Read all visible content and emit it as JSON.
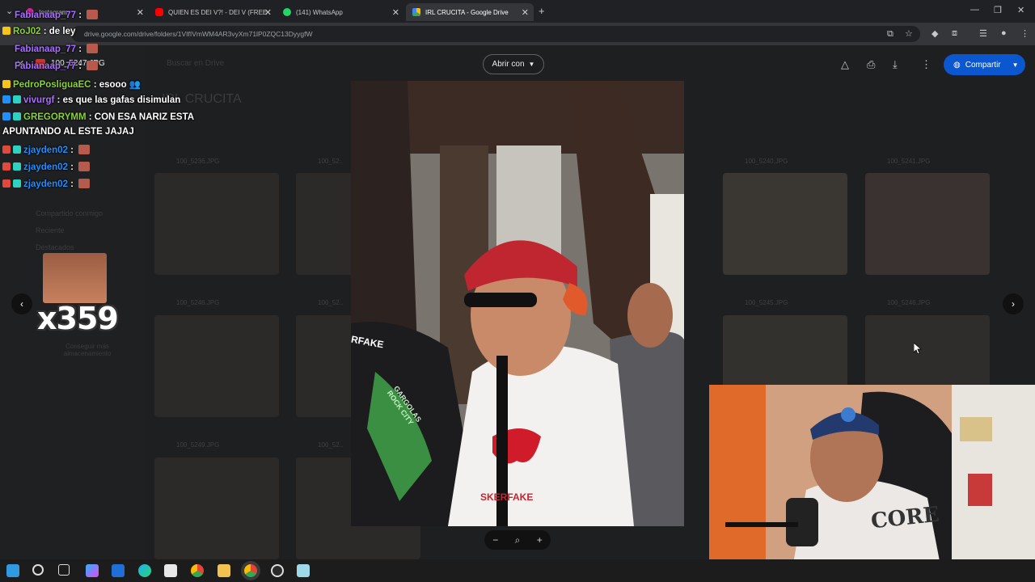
{
  "browser": {
    "tabs": [
      {
        "label": "Instagram",
        "icon": "instagram-icon",
        "color": "#d6249f"
      },
      {
        "label": "QUIEN ES DEI V?! - DEI V (FREE",
        "icon": "youtube-icon",
        "color": "#ff0000"
      },
      {
        "label": "(141) WhatsApp",
        "icon": "whatsapp-icon",
        "color": "#25d366"
      },
      {
        "label": "IRL CRUCITA - Google Drive",
        "icon": "drive-icon",
        "color": "#4285f4",
        "active": true
      }
    ],
    "new_tab": "+",
    "close_glyph": "✕",
    "url": "drive.google.com/drive/folders/1VIfIVmWM4AR3vyXm71lP0ZQC13DyygfW"
  },
  "viewer": {
    "filename": "100_5247.JPG",
    "open_with": "Abrir con",
    "share": "Compartir"
  },
  "drive_bg": {
    "search_placeholder": "Buscar en Drive",
    "folder_title": "IRL CRUCITA",
    "thumb_labels": [
      "100_5236.JPG",
      "100_52..",
      "100_5240.JPG",
      "100_5241.JPG",
      "100_5246.JPG",
      "100_52..",
      "100_5245.JPG",
      "100_5246.JPG",
      "100_5249.JPG",
      "100_52.."
    ],
    "sidebar_items": [
      "Compartido conmigo",
      "Reciente",
      "Destacados"
    ],
    "storage_button": "Conseguir más almacenamiento"
  },
  "chat": [
    {
      "user": "Fabianaap_77",
      "color": "#a970ff",
      "text": "",
      "emote": true
    },
    {
      "user": "RoJ02",
      "color": "#8bd13a",
      "text": "de ley",
      "emote": false
    },
    {
      "user": "Fabianaap_77",
      "color": "#a970ff",
      "text": "",
      "emote": true
    },
    {
      "user": "Fabianaap_77",
      "color": "#a970ff",
      "text": "",
      "emote": true
    },
    {
      "user": "PedroPosliguaEC",
      "color": "#8bd13a",
      "text": "esooo",
      "emote": false
    },
    {
      "user": "vivurgf",
      "color": "#a970ff",
      "text": "es que las gafas disimulan",
      "emote": false
    },
    {
      "user": "GREGORYMM",
      "color": "#8bd13a",
      "text": "CON ESA NARIZ ESTA",
      "emote": false
    },
    {
      "user": "",
      "color": "#ffffff",
      "text": "APUNTANDO AL ESTE JAJAJ",
      "emote": false
    },
    {
      "user": "zjayden02",
      "color": "#1e90ff",
      "text": "",
      "emote": true
    },
    {
      "user": "zjayden02",
      "color": "#1e90ff",
      "text": "",
      "emote": true
    },
    {
      "user": "zjayden02",
      "color": "#1e90ff",
      "text": "",
      "emote": true
    }
  ],
  "emote_counter": "x359",
  "photo_print": {
    "shirt_text": "SKERFAKE",
    "left_shirt": "RFAKE",
    "patch_text": "GARGOLAS ROCK CITY"
  },
  "webcam_shirt": "CORE",
  "taskbar_apps": [
    "windows-start-icon",
    "search-icon",
    "task-view-icon",
    "copilot-icon",
    "outlook-icon",
    "edge-icon",
    "store-icon",
    "chrome-icon",
    "file-explorer-icon",
    "chrome-profile-icon",
    "obs-icon",
    "notepad-icon"
  ]
}
